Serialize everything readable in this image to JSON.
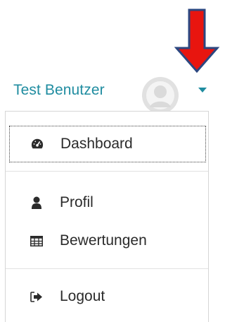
{
  "user_menu": {
    "name": "Test Benutzer",
    "avatar_icon": "user-avatar-placeholder",
    "caret_icon": "caret-down-icon",
    "accent_color": "#1f8ca0"
  },
  "annotation": {
    "arrow_icon": "red-down-arrow",
    "color": "#e8150f"
  },
  "dropdown": {
    "items": [
      {
        "label": "Dashboard",
        "icon": "dashboard-icon"
      },
      {
        "label": "Profil",
        "icon": "user-icon"
      },
      {
        "label": "Bewertungen",
        "icon": "table-icon"
      },
      {
        "label": "Logout",
        "icon": "sign-out-icon"
      }
    ]
  }
}
